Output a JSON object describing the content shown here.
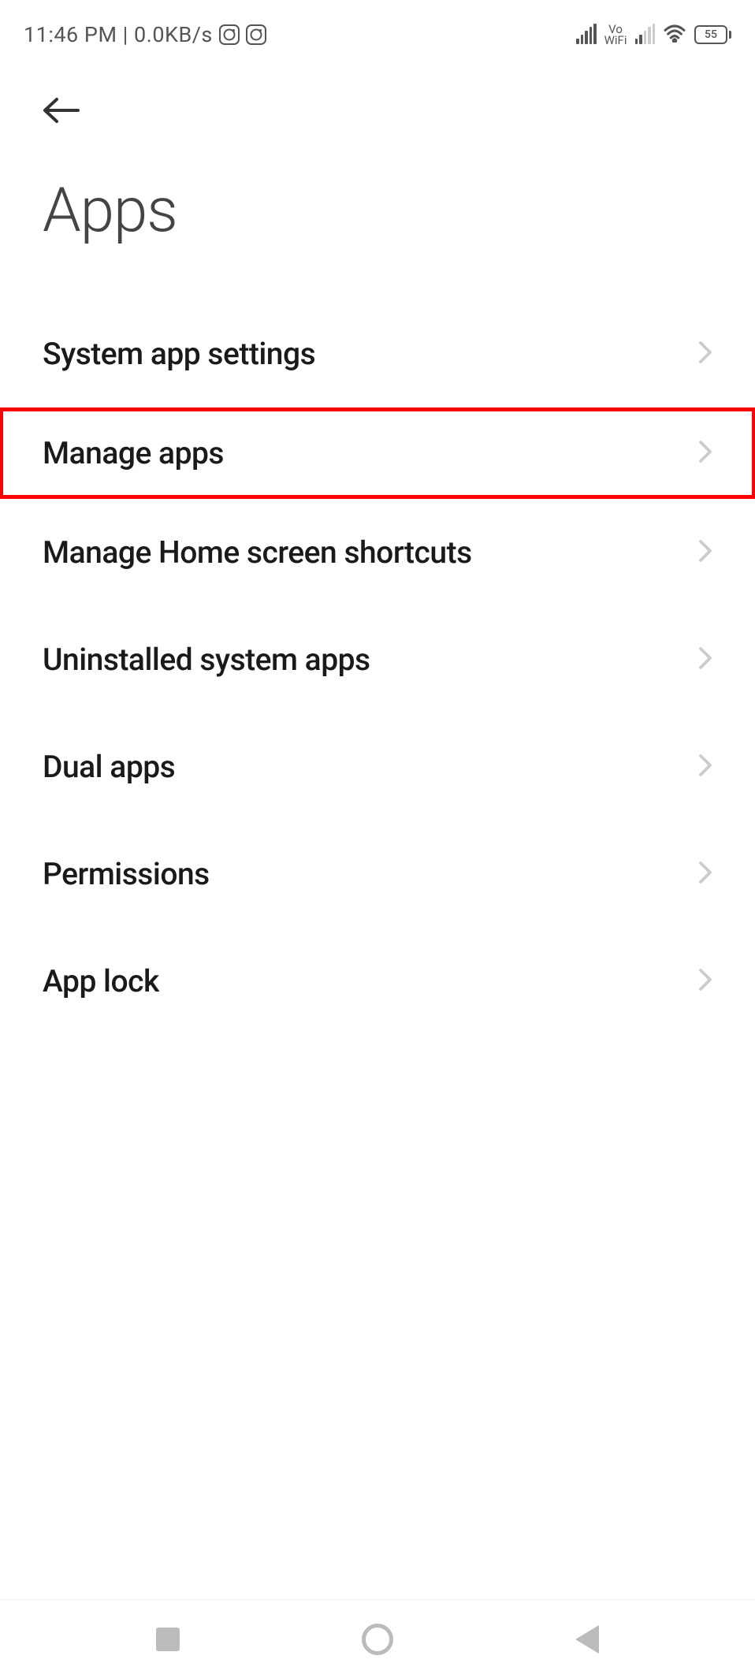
{
  "status_bar": {
    "time": "11:46 PM",
    "data_rate": "0.0KB/s",
    "vowifi_top": "Vo",
    "vowifi_bottom": "WiFi",
    "battery_level": "55"
  },
  "header": {
    "title": "Apps"
  },
  "menu": {
    "items": [
      {
        "label": "System app settings",
        "highlighted": false
      },
      {
        "label": "Manage apps",
        "highlighted": true
      },
      {
        "label": "Manage Home screen shortcuts",
        "highlighted": false
      },
      {
        "label": "Uninstalled system apps",
        "highlighted": false
      },
      {
        "label": "Dual apps",
        "highlighted": false
      },
      {
        "label": "Permissions",
        "highlighted": false
      },
      {
        "label": "App lock",
        "highlighted": false
      }
    ]
  }
}
